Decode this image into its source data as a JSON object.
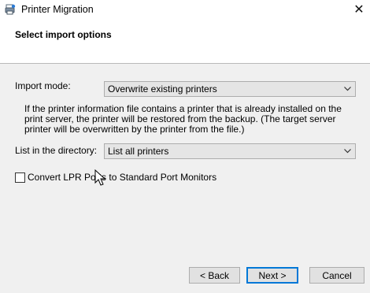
{
  "window": {
    "title": "Printer Migration",
    "close_symbol": "✕",
    "app_icon": "printer-migration-icon"
  },
  "header": {
    "title": "Select import options"
  },
  "import_mode": {
    "label": "Import mode:",
    "value": "Overwrite existing printers",
    "description": "If the printer information file contains a printer that is already installed on the print server, the printer will be restored from the backup.  (The target server printer will be overwritten by the printer from the file.)"
  },
  "list_directory": {
    "label": "List in the directory:",
    "value": "List all printers"
  },
  "lpr_checkbox": {
    "label": "Convert LPR Ports to Standard Port Monitors",
    "checked": false
  },
  "buttons": {
    "back": "< Back",
    "next": "Next >",
    "cancel": "Cancel"
  },
  "colors": {
    "content_bg": "#f0f0f0",
    "default_button_border": "#0078d7"
  }
}
